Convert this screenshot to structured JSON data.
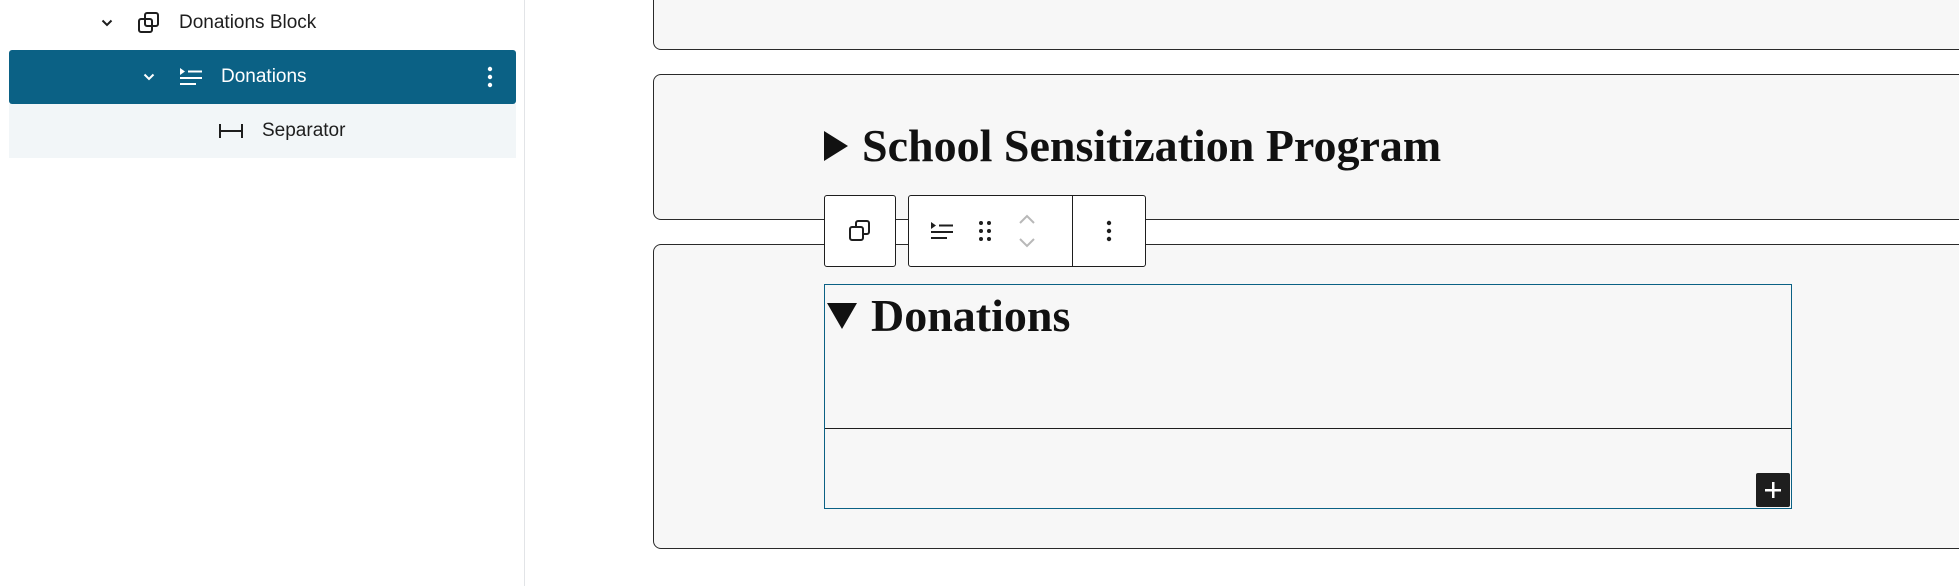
{
  "list_view": {
    "items": [
      {
        "label": "Donations Block",
        "icon": "block-copy-icon",
        "expanded": true
      },
      {
        "label": "Donations",
        "icon": "details-icon",
        "expanded": true,
        "selected": true
      },
      {
        "label": "Separator",
        "icon": "separator-icon"
      }
    ]
  },
  "canvas": {
    "partial_heading": "…",
    "details": [
      {
        "summary": "School Sensitization Program",
        "open": false
      },
      {
        "summary": "Donations",
        "open": true
      }
    ]
  },
  "colors": {
    "accent": "#0b6185",
    "panel_bg": "#f7f7f7",
    "selected_row_bg": "#0b6185",
    "child_row_bg": "#f2f6f8"
  }
}
